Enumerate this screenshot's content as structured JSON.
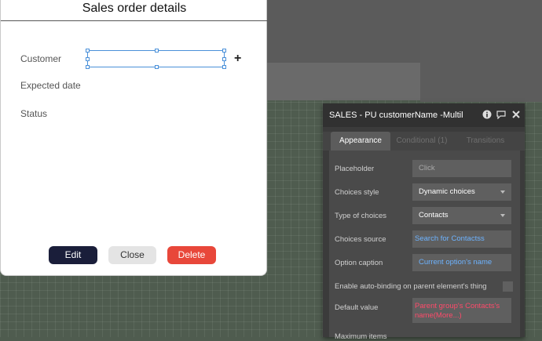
{
  "popup": {
    "title": "Sales order details",
    "fields": {
      "customer": "Customer",
      "expected_date": "Expected date",
      "status": "Status"
    },
    "buttons": {
      "edit": "Edit",
      "close": "Close",
      "delete": "Delete"
    }
  },
  "property_editor": {
    "title": "SALES - PU customerName -Multil",
    "tabs": [
      "Appearance",
      "Conditional (1)",
      "Transitions"
    ],
    "rows": [
      {
        "label": "Placeholder",
        "value": "Click"
      },
      {
        "label": "Choices style",
        "value": "Dynamic choices"
      },
      {
        "label": "Type of choices",
        "value": "Contacts"
      },
      {
        "label": "Choices source",
        "value": "Search for Contactss"
      },
      {
        "label": "Option caption",
        "value": "Current option's name"
      },
      {
        "label": "Enable auto-binding on parent element's thing",
        "value": ""
      },
      {
        "label": "Default value",
        "value": "Parent group's Contacts's name(More...)"
      },
      {
        "label": "Maximum items",
        "value": ""
      }
    ]
  },
  "colors": {
    "canvas_bg": "#4f5c4f",
    "edit_button": "#1a1e3a",
    "delete_button": "#e8473a",
    "link_text": "#6db3ff",
    "dynamic_text": "#ff4a6a"
  }
}
